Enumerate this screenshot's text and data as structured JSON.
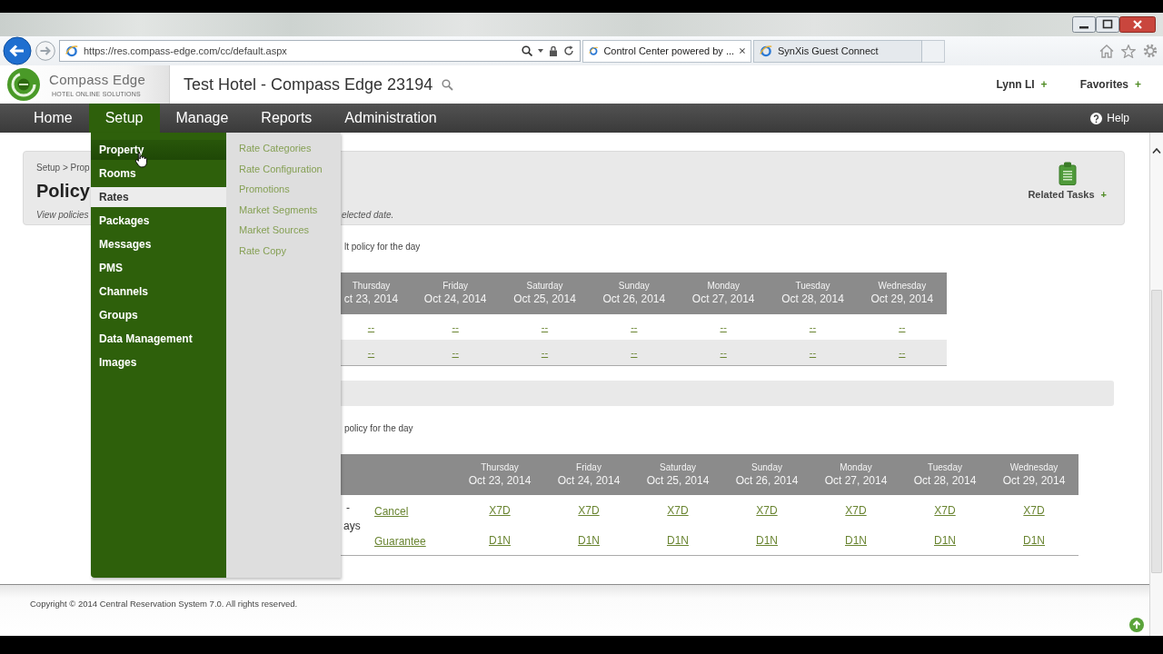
{
  "browser": {
    "address": "https://res.compass-edge.com/cc/default.aspx",
    "tabs": [
      {
        "title": "Control Center powered by ...",
        "selected": true,
        "closable": true
      },
      {
        "title": "SynXis Guest Connect",
        "selected": false,
        "closable": false
      }
    ]
  },
  "header": {
    "logo_name": "Compass Edge",
    "logo_tagline": "HOTEL ONLINE SOLUTIONS",
    "hotel_title": "Test Hotel - Compass Edge 23194",
    "links": [
      {
        "label": "Lynn LI",
        "expander": "+"
      },
      {
        "label": "Favorites",
        "expander": "+"
      }
    ]
  },
  "nav": {
    "items": [
      {
        "label": "Home",
        "selected": false
      },
      {
        "label": "Setup",
        "selected": true
      },
      {
        "label": "Manage",
        "selected": false
      },
      {
        "label": "Reports",
        "selected": false
      },
      {
        "label": "Administration",
        "selected": false
      }
    ],
    "help": "Help"
  },
  "setup_menu": {
    "items": [
      {
        "label": "Property",
        "hovered": true,
        "selected": false
      },
      {
        "label": "Rooms",
        "hovered": false,
        "selected": false
      },
      {
        "label": "Rates",
        "hovered": false,
        "selected": true
      },
      {
        "label": "Packages",
        "hovered": false,
        "selected": false
      },
      {
        "label": "Messages",
        "hovered": false,
        "selected": false
      },
      {
        "label": "PMS",
        "hovered": false,
        "selected": false
      },
      {
        "label": "Channels",
        "hovered": false,
        "selected": false
      },
      {
        "label": "Groups",
        "hovered": false,
        "selected": false
      },
      {
        "label": "Data Management",
        "hovered": false,
        "selected": false
      },
      {
        "label": "Images",
        "hovered": false,
        "selected": false
      }
    ],
    "submenu": [
      "Rate Categories",
      "Rate Configuration",
      "Promotions",
      "Market Segments",
      "Market Sources",
      "Rate Copy"
    ]
  },
  "page_header": {
    "breadcrumb": "Setup > Prop",
    "title": "Policy",
    "description": "View policies",
    "description_end": "elected date.",
    "related_tasks": {
      "label": "Related Tasks",
      "expander": "+"
    }
  },
  "policy_table_1": {
    "note": "lt policy for the day",
    "columns": [
      {
        "day": "Thursday",
        "date": "ct 23, 2014"
      },
      {
        "day": "Friday",
        "date": "Oct 24, 2014"
      },
      {
        "day": "Saturday",
        "date": "Oct 25, 2014"
      },
      {
        "day": "Sunday",
        "date": "Oct 26, 2014"
      },
      {
        "day": "Monday",
        "date": "Oct 27, 2014"
      },
      {
        "day": "Tuesday",
        "date": "Oct 28, 2014"
      },
      {
        "day": "Wednesday",
        "date": "Oct 29, 2014"
      }
    ],
    "rows": [
      [
        "--",
        "--",
        "--",
        "--",
        "--",
        "--",
        "--"
      ],
      [
        "--",
        "--",
        "--",
        "--",
        "--",
        "--",
        "--"
      ]
    ]
  },
  "policy_table_2": {
    "note": "policy for the day",
    "columns": [
      {
        "day": "Thursday",
        "date": "Oct 23, 2014"
      },
      {
        "day": "Friday",
        "date": "Oct 24, 2014"
      },
      {
        "day": "Saturday",
        "date": "Oct 25, 2014"
      },
      {
        "day": "Sunday",
        "date": "Oct 26, 2014"
      },
      {
        "day": "Monday",
        "date": "Oct 27, 2014"
      },
      {
        "day": "Tuesday",
        "date": "Oct 28, 2014"
      },
      {
        "day": "Wednesday",
        "date": "Oct 29, 2014"
      }
    ],
    "label_lines": [
      "-",
      "ays"
    ],
    "rows": [
      {
        "type": "Cancel",
        "codes": [
          "X7D",
          "X7D",
          "X7D",
          "X7D",
          "X7D",
          "X7D",
          "X7D"
        ]
      },
      {
        "type": "Guarantee",
        "codes": [
          "D1N",
          "D1N",
          "D1N",
          "D1N",
          "D1N",
          "D1N",
          "D1N"
        ]
      }
    ]
  },
  "footer": {
    "copyright": "Copyright © 2014 Central Reservation System 7.0. All rights reserved."
  }
}
